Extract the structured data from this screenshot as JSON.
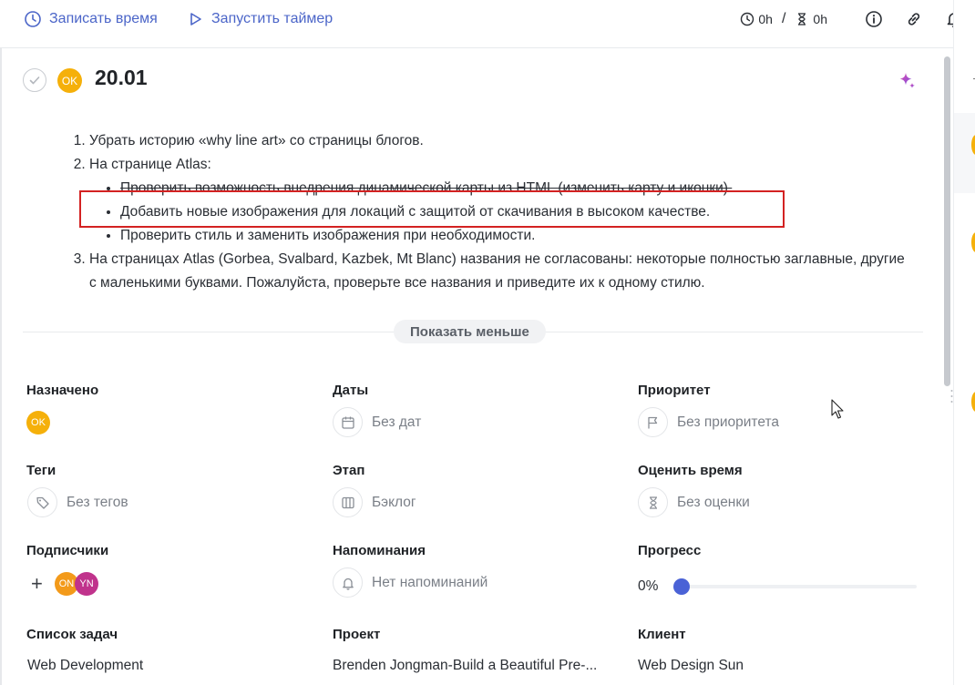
{
  "toolbar": {
    "log_time_label": "Записать время",
    "start_timer_label": "Запустить таймер",
    "time_tracked": "0h",
    "time_separator": "/",
    "time_estimated": "0h"
  },
  "task": {
    "assignee_initials": "OK",
    "title": "20.01"
  },
  "description": {
    "item1": "Убрать историю «why line art» со страницы блогов.",
    "item2": "На странице Atlas:",
    "sub1": "Проверить возможность внедрения динамической карты из HTML (изменить карту и иконки).",
    "sub2": "Добавить новые изображения для локаций с защитой от скачивания в высоком качестве.",
    "sub3": "Проверить стиль и заменить изображения при необходимости.",
    "item3": "На страницах Atlas (Gorbea, Svalbard, Kazbek, Mt Blanc) названия не согласованы: некоторые полностью заглавные, другие с маленькими буквами. Пожалуйста, проверьте все названия и приведите их к одному стилю."
  },
  "show_less_label": "Показать меньше",
  "fields": {
    "assigned": {
      "label": "Назначено",
      "avatar": "OK"
    },
    "dates": {
      "label": "Даты",
      "value": "Без дат"
    },
    "priority": {
      "label": "Приоритет",
      "value": "Без приоритета"
    },
    "tags": {
      "label": "Теги",
      "value": "Без тегов"
    },
    "stage": {
      "label": "Этап",
      "value": "Бэклог"
    },
    "estimate": {
      "label": "Оценить время",
      "value": "Без оценки"
    },
    "subscribers": {
      "label": "Подписчики",
      "add": "+",
      "avatars": [
        "ON",
        "YN"
      ]
    },
    "reminders": {
      "label": "Напоминания",
      "value": "Нет напоминаний"
    },
    "progress": {
      "label": "Прогресс",
      "value": "0%",
      "fraction": 0
    },
    "task_list": {
      "label": "Список задач",
      "value": "Web Development"
    },
    "project": {
      "label": "Проект",
      "value": "Brenden Jongman-Build a Beautiful Pre-..."
    },
    "client": {
      "label": "Клиент",
      "value": "Web Design Sun"
    }
  },
  "colors": {
    "accent": "#4b65c8",
    "avatar_ok": "#f5b00a",
    "avatar_on": "#f39a1a",
    "avatar_yn": "#c0338c",
    "highlight_box": "#d32222",
    "progress_knob": "#4a62d6"
  }
}
